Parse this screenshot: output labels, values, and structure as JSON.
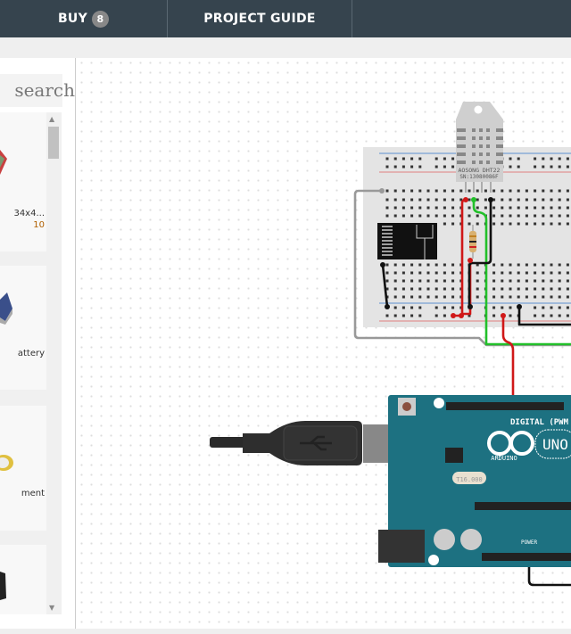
{
  "header": {
    "buy_label": "BUY",
    "buy_count": "8",
    "guide_label": "PROJECT GUIDE"
  },
  "sidebar": {
    "search_placeholder": "search",
    "items": [
      {
        "label_line1": "34x4...",
        "label_line2": "10"
      },
      {
        "label_line1": "attery"
      },
      {
        "label_line1": "ment"
      },
      {
        "label_line1": ""
      }
    ]
  },
  "circuit": {
    "sensor_model": "AOSONG DHT22",
    "sensor_serial": "SN:13080086F",
    "board_brand": "ARDUINO",
    "board_model": "UNO",
    "digital_label": "DIGITAL (PWM",
    "power_label": "POWER",
    "crystal_label": "T16.000",
    "wire_colors": {
      "red": "#d01818",
      "black": "#111111",
      "green": "#22c02a",
      "gray": "#999999",
      "orange": "#f07a10"
    },
    "board_color": "#1d7181"
  }
}
